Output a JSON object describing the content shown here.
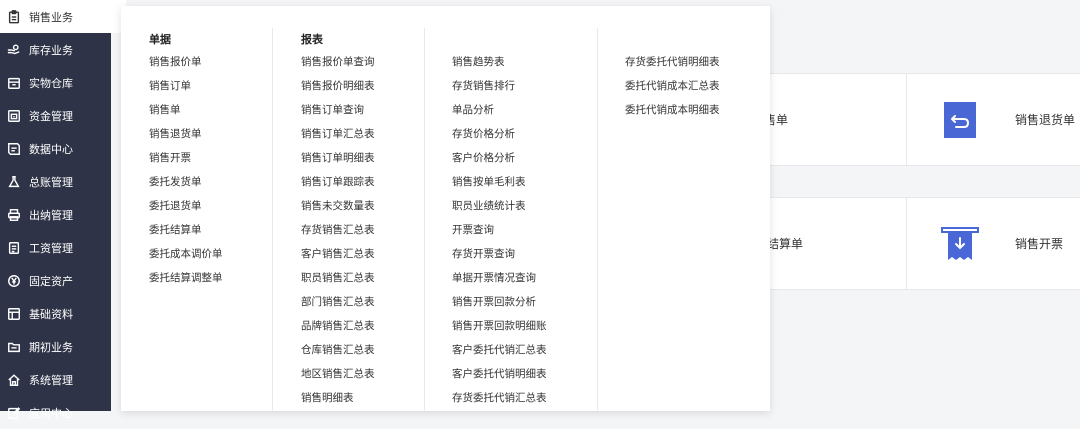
{
  "sidebar": {
    "items": [
      {
        "label": "销售业务",
        "icon": "clipboard-icon",
        "active": true
      },
      {
        "label": "库存业务",
        "icon": "hand-coin-icon"
      },
      {
        "label": "实物仓库",
        "icon": "box-icon"
      },
      {
        "label": "资金管理",
        "icon": "safe-icon"
      },
      {
        "label": "数据中心",
        "icon": "chart-doc-icon"
      },
      {
        "label": "总账管理",
        "icon": "flask-icon"
      },
      {
        "label": "出纳管理",
        "icon": "printer-icon"
      },
      {
        "label": "工资管理",
        "icon": "document-icon"
      },
      {
        "label": "固定资产",
        "icon": "yen-circle-icon"
      },
      {
        "label": "基础资料",
        "icon": "window-icon"
      },
      {
        "label": "期初业务",
        "icon": "folder-icon"
      },
      {
        "label": "系统管理",
        "icon": "home-icon"
      },
      {
        "label": "应用中心",
        "icon": "edit-icon"
      }
    ]
  },
  "dropdown": {
    "col1": {
      "title": "单据",
      "items": [
        "销售报价单",
        "销售订单",
        "销售单",
        "销售退货单",
        "销售开票",
        "委托发货单",
        "委托退货单",
        "委托结算单",
        "委托成本调价单",
        "委托结算调整单"
      ]
    },
    "col2": {
      "title": "报表",
      "items": [
        "销售报价单查询",
        "销售报价明细表",
        "销售订单查询",
        "销售订单汇总表",
        "销售订单明细表",
        "销售订单跟踪表",
        "销售未交数量表",
        "存货销售汇总表",
        "客户销售汇总表",
        "职员销售汇总表",
        "部门销售汇总表",
        "品牌销售汇总表",
        "仓库销售汇总表",
        "地区销售汇总表",
        "销售明细表"
      ]
    },
    "col3": {
      "items": [
        "销售趋势表",
        "存货销售排行",
        "单品分析",
        "存货价格分析",
        "客户价格分析",
        "销售按单毛利表",
        "职员业绩统计表",
        "开票查询",
        "存货开票查询",
        "单据开票情况查询",
        "销售开票回款分析",
        "销售开票回款明细账",
        "客户委托代销汇总表",
        "客户委托代销明细表",
        "存货委托代销汇总表"
      ]
    },
    "col4": {
      "items": [
        "存货委托代销明细表",
        "委托代销成本汇总表",
        "委托代销成本明细表"
      ]
    }
  },
  "cards": {
    "card1_label": "售单",
    "card2_label": "销售退货单",
    "card3_label": "托结算单",
    "card4_label": "销售开票"
  },
  "colors": {
    "sidebar_bg": "#2e3347",
    "accent_blue": "#4a67d6"
  }
}
